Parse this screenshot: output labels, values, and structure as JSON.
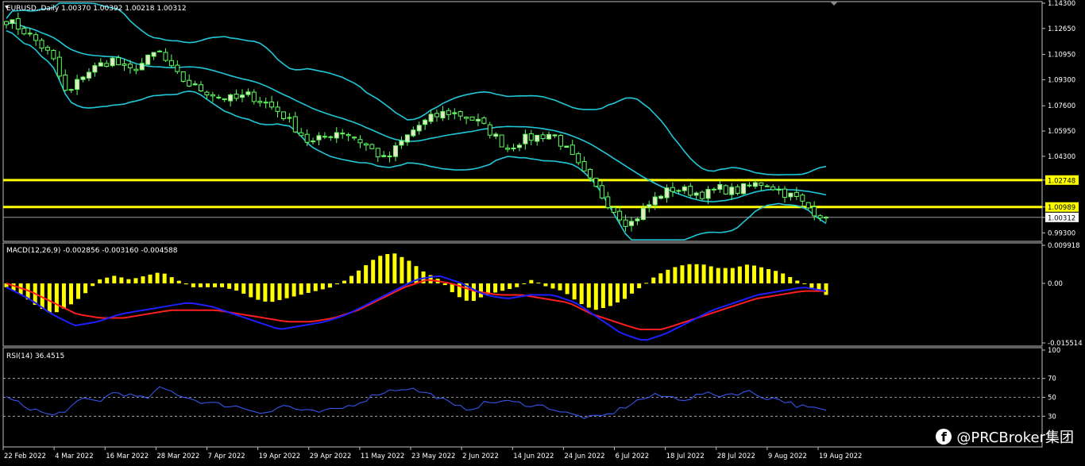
{
  "main": {
    "title": "EURUSD,,Daily  1.00370 1.00392 1.00218 1.00312",
    "price_ticks": [
      "1.14300",
      "1.12650",
      "1.10950",
      "1.09300",
      "1.07600",
      "1.05950",
      "1.04300",
      "1.02748",
      "1.00989",
      "1.00312",
      "0.99300"
    ],
    "price_tick_values": [
      1.143,
      1.1265,
      1.1095,
      1.093,
      1.076,
      1.0595,
      1.043,
      1.02748,
      1.00989,
      1.00312,
      0.993
    ],
    "hlines": [
      1.02748,
      1.00989
    ],
    "last_price": 1.00312
  },
  "macd": {
    "title": "MACD(12,26,9) -0.002856 -0.003160 -0.004588",
    "ticks": [
      "0.009918",
      "0.00",
      "-0.015514"
    ],
    "tick_values": [
      0.009918,
      0.0,
      -0.015514
    ]
  },
  "rsi": {
    "title": "RSI(14) 36.4515",
    "ticks": [
      "100",
      "70",
      "50",
      "30"
    ],
    "tick_values": [
      100,
      70,
      50,
      30
    ]
  },
  "x_ticks": [
    "22 Feb 2022",
    "4 Mar 2022",
    "16 Mar 2022",
    "28 Mar 2022",
    "7 Apr 2022",
    "19 Apr 2022",
    "29 Apr 2022",
    "11 May 2022",
    "23 May 2022",
    "2 Jun 2022",
    "14 Jun 2022",
    "24 Jun 2022",
    "6 Jul 2022",
    "18 Jul 2022",
    "28 Jul 2022",
    "9 Aug 2022",
    "19 Aug 2022"
  ],
  "watermark": "@PRCBroker集团",
  "colors": {
    "bull": "#e8e8c8",
    "bear": "#ffffff",
    "wick": "#5fff5f",
    "bands": "#20c8d8",
    "hline": "#ffff00",
    "macd_hist": "#ffff00",
    "macd_line": "#1e1eff",
    "signal_line": "#ff1e1e",
    "rsi_line": "#3a5cff",
    "grid": "#c0c0c0"
  },
  "chart_data": [
    {
      "type": "candlestick",
      "title": "EURUSD,,Daily",
      "x": [
        "22 Feb 2022",
        "4 Mar 2022",
        "16 Mar 2022",
        "28 Mar 2022",
        "7 Apr 2022",
        "19 Apr 2022",
        "29 Apr 2022",
        "11 May 2022",
        "23 May 2022",
        "2 Jun 2022",
        "14 Jun 2022",
        "24 Jun 2022",
        "6 Jul 2022",
        "18 Jul 2022",
        "28 Jul 2022",
        "9 Aug 2022",
        "19 Aug 2022"
      ],
      "close_path": [
        1.132,
        1.126,
        1.118,
        1.108,
        1.082,
        1.096,
        1.102,
        1.106,
        1.098,
        1.104,
        1.112,
        1.098,
        1.09,
        1.086,
        1.082,
        1.08,
        1.083,
        1.078,
        1.072,
        1.062,
        1.051,
        1.056,
        1.06,
        1.055,
        1.048,
        1.04,
        1.052,
        1.062,
        1.068,
        1.072,
        1.07,
        1.066,
        1.058,
        1.048,
        1.054,
        1.056,
        1.058,
        1.046,
        1.032,
        1.02,
        1.008,
        0.998,
        1.008,
        1.018,
        1.022,
        1.02,
        1.018,
        1.022,
        1.02,
        1.024,
        1.026,
        1.02,
        1.016,
        1.008,
        1.0031
      ],
      "ylim": [
        0.9885,
        1.143
      ],
      "hlines": [
        1.02748,
        1.00989
      ]
    },
    {
      "type": "bar",
      "title": "MACD(12,26,9)",
      "histogram": [
        -0.001,
        -0.003,
        -0.006,
        -0.008,
        -0.006,
        -0.003,
        0.001,
        0.002,
        0.001,
        0.002,
        0.003,
        0.001,
        -0.001,
        -0.001,
        -0.001,
        -0.002,
        -0.004,
        -0.005,
        -0.004,
        -0.003,
        -0.002,
        -0.001,
        0.001,
        0.004,
        0.007,
        0.008,
        0.006,
        0.003,
        0.001,
        -0.003,
        -0.005,
        -0.003,
        -0.002,
        -0.001,
        0.001,
        -0.001,
        -0.002,
        -0.005,
        -0.007,
        -0.006,
        -0.004,
        -0.001,
        0.002,
        0.004,
        0.005,
        0.005,
        0.004,
        0.004,
        0.005,
        0.004,
        0.003,
        0.001,
        -0.001,
        -0.003
      ],
      "macd_line": [
        -0.001,
        -0.004,
        -0.008,
        -0.011,
        -0.01,
        -0.008,
        -0.007,
        -0.006,
        -0.005,
        -0.006,
        -0.008,
        -0.01,
        -0.012,
        -0.011,
        -0.01,
        -0.008,
        -0.005,
        -0.002,
        0.001,
        0.002,
        0.0,
        -0.003,
        -0.004,
        -0.003,
        -0.003,
        -0.005,
        -0.009,
        -0.013,
        -0.015,
        -0.013,
        -0.01,
        -0.007,
        -0.005,
        -0.003,
        -0.002,
        -0.001,
        -0.002
      ],
      "signal_line": [
        0.0,
        -0.002,
        -0.005,
        -0.008,
        -0.009,
        -0.009,
        -0.008,
        -0.007,
        -0.007,
        -0.007,
        -0.008,
        -0.009,
        -0.01,
        -0.01,
        -0.009,
        -0.007,
        -0.004,
        -0.001,
        0.001,
        0.0,
        -0.002,
        -0.003,
        -0.003,
        -0.004,
        -0.005,
        -0.008,
        -0.01,
        -0.012,
        -0.012,
        -0.01,
        -0.008,
        -0.006,
        -0.004,
        -0.003,
        -0.002,
        -0.002
      ],
      "ylim": [
        -0.015514,
        0.009918
      ]
    },
    {
      "type": "line",
      "title": "RSI(14)",
      "values": [
        50,
        42,
        36,
        30,
        38,
        48,
        46,
        56,
        52,
        48,
        60,
        54,
        48,
        44,
        42,
        40,
        36,
        34,
        42,
        36,
        34,
        36,
        40,
        46,
        54,
        58,
        60,
        55,
        50,
        40,
        38,
        44,
        46,
        44,
        42,
        40,
        34,
        30,
        28,
        32,
        40,
        48,
        52,
        50,
        48,
        54,
        52,
        54,
        56,
        50,
        48,
        42,
        38,
        36.4515
      ],
      "ylim": [
        0,
        100
      ],
      "levels": [
        70,
        50,
        30
      ]
    }
  ]
}
